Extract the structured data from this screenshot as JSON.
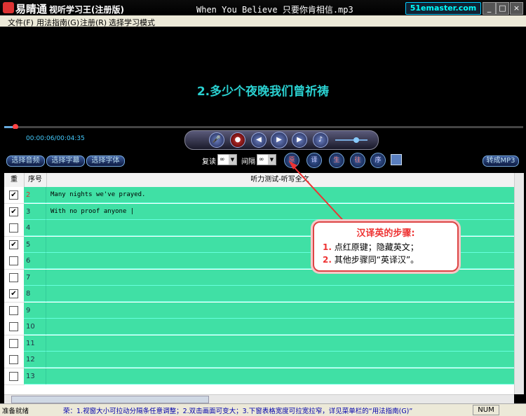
{
  "window": {
    "app_name": "易睛通",
    "app_subtitle": "视听学习王(注册版)",
    "track_title": "When You Believe 只要你肯相信.mp3",
    "brand": "51emaster.com",
    "minimize": "_",
    "maximize": "□",
    "close": "×"
  },
  "menu": {
    "file": "文件(F)",
    "guide": "用法指南(G)",
    "register": "注册(R)",
    "mode": "选择学习模式"
  },
  "player": {
    "subtitle": "2.多少个夜晚我们曾祈祷",
    "time": "00:00:06/00:04:35",
    "progress": 0.022,
    "volume": 0.65
  },
  "toolbar": {
    "select_audio": "选择音频",
    "select_subtitle": "选择字幕",
    "select_font": "选择字体",
    "repeat_label": "复读",
    "repeat_value": "∞",
    "interval_label": "间隔",
    "interval_value": "∞",
    "btn_orig": "原",
    "btn_translate": "译",
    "btn_gen": "生",
    "btn_past": "往",
    "btn_seq": "序",
    "convert_mp3": "转成MP3"
  },
  "table": {
    "headers": {
      "repeat": "重",
      "index": "序号",
      "content": "听力测试-听写全文"
    },
    "rows": [
      {
        "checked": true,
        "num": "2",
        "text": "Many nights we've prayed."
      },
      {
        "checked": true,
        "num": "3",
        "text": "With no proof anyone |"
      },
      {
        "checked": false,
        "num": "4",
        "text": ""
      },
      {
        "checked": true,
        "num": "5",
        "text": ""
      },
      {
        "checked": false,
        "num": "6",
        "text": ""
      },
      {
        "checked": false,
        "num": "7",
        "text": ""
      },
      {
        "checked": true,
        "num": "8",
        "text": ""
      },
      {
        "checked": false,
        "num": "9",
        "text": ""
      },
      {
        "checked": false,
        "num": "10",
        "text": ""
      },
      {
        "checked": false,
        "num": "11",
        "text": ""
      },
      {
        "checked": false,
        "num": "12",
        "text": ""
      },
      {
        "checked": false,
        "num": "13",
        "text": ""
      }
    ]
  },
  "callout": {
    "title": "汉译英的步骤:",
    "step1_num": "1.",
    "step1_text": "点红原键；隐藏英文；",
    "step2_num": "2.",
    "step2_text": "其他步骤同“英译汉”。"
  },
  "status": {
    "left": "准备就绪",
    "hint": "荣：1.视窗大小可拉动分隔条任意调整；2.双击画面可变大；3.下窗表格宽度可拉宽拉窄，详见菜单栏的“用法指南(G)”",
    "num": "NUM"
  },
  "colors": {
    "row_green": "#40e0a5",
    "subtitle_cyan": "#2ad0d0",
    "callout_red": "#e33"
  }
}
